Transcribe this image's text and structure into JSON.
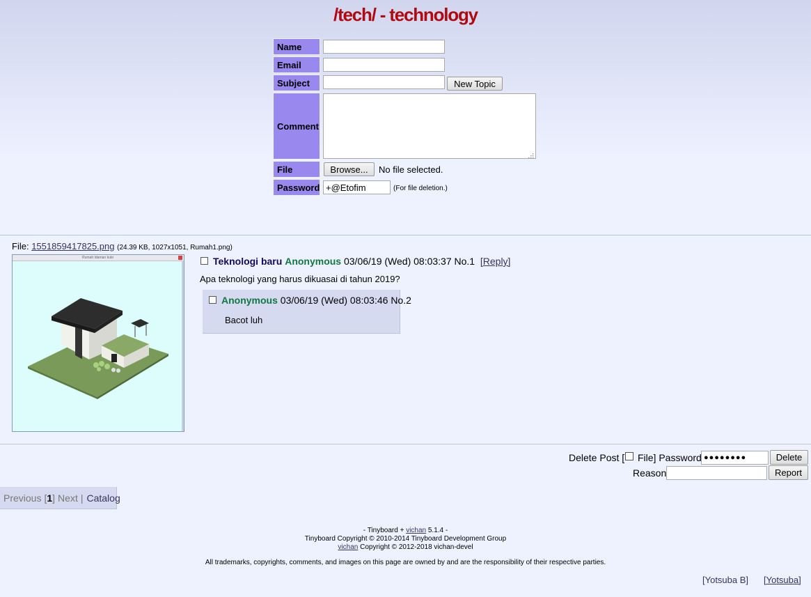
{
  "board": {
    "title": "/tech/ - technology"
  },
  "form": {
    "name_label": "Name",
    "email_label": "Email",
    "subject_label": "Subject",
    "comment_label": "Comment",
    "file_label": "File",
    "password_label": "Password",
    "name_value": "",
    "email_value": "",
    "subject_value": "",
    "comment_value": "",
    "new_topic_button": "New Topic",
    "browse_button": "Browse...",
    "file_status": "No file selected.",
    "password_value": "+@Etofim",
    "password_note": "(For file deletion.)"
  },
  "thread": {
    "file_prefix": "File:",
    "file_name": "1551859417825.png",
    "file_info": "(24.39 KB, 1027x1051, Rumah1.png)",
    "thumb_window_title": "Rumah Idaman kubi",
    "op": {
      "subject": "Teknologi baru",
      "name": "Anonymous",
      "date": "03/06/19 (Wed) 08:03:37",
      "no": "No.1",
      "reply_link": "[Reply]",
      "body": "Apa teknologi yang harus dikuasai di tahun 2019?"
    },
    "reply": {
      "name": "Anonymous",
      "date": "03/06/19 (Wed) 08:03:46",
      "no": "No.2",
      "body": "Bacot luh"
    }
  },
  "delete_form": {
    "delete_post_label": "Delete Post [",
    "file_label": "File] Password",
    "password_mask": "●●●●●●●●",
    "delete_button": "Delete",
    "reason_label": "Reason",
    "reason_value": "",
    "report_button": "Report"
  },
  "pagination": {
    "previous": "Previous",
    "open_bracket": "[",
    "current_page": "1",
    "close_bracket": "]",
    "next": "Next",
    "separator": "|",
    "catalog": "Catalog"
  },
  "footer": {
    "line1_prefix": "- Tinyboard + ",
    "line1_link": "vichan",
    "line1_suffix": " 5.1.4 -",
    "line2": "Tinyboard Copyright © 2010-2014 Tinyboard Development Group",
    "line3_link": "vichan",
    "line3_suffix": " Copyright © 2012-2018 vichan-devel",
    "disclaimer": "All trademarks, copyrights, comments, and images on this page are owned by and are the responsibility of their respective parties."
  },
  "styles": {
    "yotsuba_b": "[Yotsuba B]",
    "yotsuba": "[Yotsuba]"
  },
  "colors": {
    "title": "#af0a0f",
    "label_bg": "#9988ee",
    "name": "#117743",
    "subject": "#0f0c5d",
    "reply_bg": "#d6daf0"
  }
}
